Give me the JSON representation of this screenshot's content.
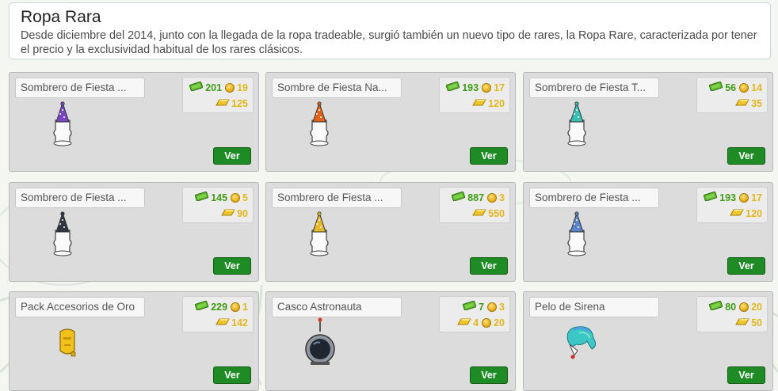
{
  "page": {
    "title": "Ropa Rara",
    "description": "Desde diciembre del 2014, junto con la llegada de la ropa tradeable, surgió también un nuevo tipo de rares, la Ropa Rare, caracterizada por tener el precio y la exclusividad habitual de los rares clásicos."
  },
  "button_label": "Ver",
  "items": [
    {
      "name": "Sombrero de Fiesta ...",
      "credits": "201",
      "coins": "19",
      "gold": "125",
      "icon": "purple-party-hat-icon"
    },
    {
      "name": "Sombre de Fiesta Na...",
      "credits": "193",
      "coins": "17",
      "gold": "120",
      "icon": "orange-party-hat-icon"
    },
    {
      "name": "Sombrero de Fiesta T...",
      "credits": "56",
      "coins": "14",
      "gold": "35",
      "icon": "teal-party-hat-icon"
    },
    {
      "name": "Sombrero de Fiesta ...",
      "credits": "145",
      "coins": "5",
      "gold": "90",
      "icon": "black-party-hat-icon"
    },
    {
      "name": "Sombrero de Fiesta ...",
      "credits": "887",
      "coins": "3",
      "gold": "550",
      "icon": "gold-party-hat-icon"
    },
    {
      "name": "Sombrero de Fiesta ...",
      "credits": "193",
      "coins": "17",
      "gold": "120",
      "icon": "blue-party-hat-icon"
    },
    {
      "name": "Pack Accesorios de Oro",
      "credits": "229",
      "coins": "1",
      "gold": "142",
      "icon": "gold-mask-icon"
    },
    {
      "name": "Casco Astronauta",
      "credits": "7",
      "coins": "3",
      "gold": "4",
      "gold_coins": "20",
      "icon": "astronaut-helmet-icon"
    },
    {
      "name": "Pelo de Sirena",
      "credits": "80",
      "coins": "20",
      "gold": "50",
      "icon": "mermaid-hair-icon"
    }
  ],
  "colors": {
    "credits_green": "#3f9b16",
    "gold_text": "#e3b61d",
    "button_green": "#1f8b25",
    "card_bg": "#dcdcdc"
  }
}
